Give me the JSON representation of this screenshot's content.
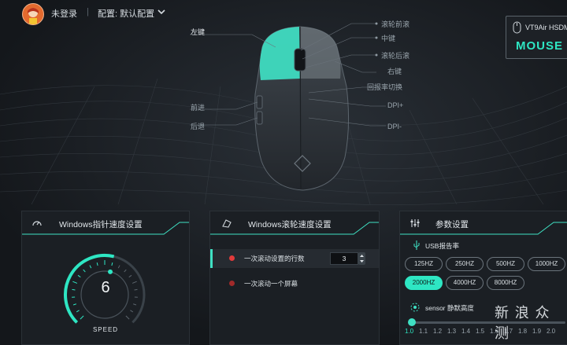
{
  "topbar": {
    "login_text": "未登录",
    "separator": "|",
    "config_text": "配置: 默认配置"
  },
  "device": {
    "model": "VT9Air HSDM",
    "kind": "MOUSE"
  },
  "mouse_labels": {
    "left": "左键",
    "scroll_up": "滚轮前滚",
    "middle": "中键",
    "scroll_down": "滚轮后滚",
    "right": "右键",
    "rate_switch": "回报率切换",
    "dpi_plus": "DPI+",
    "dpi_minus": "DPI-",
    "forward": "前进",
    "back": "后退"
  },
  "pointer_panel": {
    "title": "Windows指针速度设置",
    "speed_value": "6",
    "speed_label": "SPEED",
    "speed_fraction": 0.55
  },
  "scroll_panel": {
    "title": "Windows滚轮速度设置",
    "option_lines": "一次滚动设置的行数",
    "lines_value": "3",
    "option_page": "一次滚动一个屏幕"
  },
  "params_panel": {
    "title": "参数设置",
    "usb_label": "USB报告率",
    "rates": [
      "125HZ",
      "250HZ",
      "500HZ",
      "1000HZ",
      "2000HZ",
      "4000HZ",
      "8000HZ"
    ],
    "selected_rate": "2000HZ",
    "lod_label": "sensor 静默高度",
    "lod_ticks": [
      "1.0",
      "1.1",
      "1.2",
      "1.3",
      "1.4",
      "1.5",
      "1.6",
      "1.7",
      "1.8",
      "1.9",
      "2.0"
    ],
    "selected_lod": "1.0"
  },
  "watermark": "新 浪 众 测",
  "colors": {
    "accent": "#2ee6c3",
    "background": "#14171b",
    "panel": "#1b1f24",
    "alert": "#e23b3b"
  }
}
